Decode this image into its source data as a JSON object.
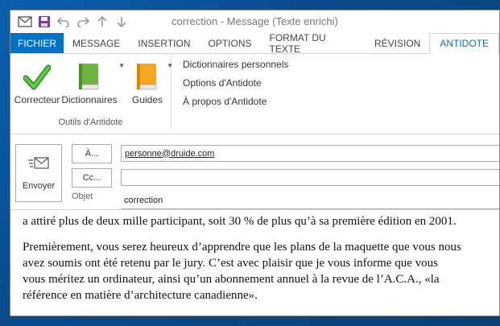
{
  "window": {
    "title": "correction - Message (Texte enrichi)"
  },
  "tabs": [
    "FICHIER",
    "MESSAGE",
    "INSERTION",
    "OPTIONS",
    "FORMAT DU TEXTE",
    "RÉVISION",
    "ANTIDOTE"
  ],
  "ribbon": {
    "big_buttons": {
      "correcteur": "Correcteur",
      "dictionnaires": "Dictionnaires",
      "guides": "Guides"
    },
    "group_label": "Outils d'Antidote",
    "menu_items": [
      "Dictionnaires personnels",
      "Options d'Antidote",
      "À propos d'Antidote"
    ]
  },
  "compose": {
    "send_label": "Envoyer",
    "to_button": "À...",
    "cc_button": "Cc...",
    "subject_label": "Objet",
    "to_value": "personne@druide.com",
    "cc_value": "",
    "subject_value": "correction"
  },
  "body_lines": [
    "a attiré plus de deux mille participant, soit 30 % de plus qu’à sa première édition en 2001.",
    "Premièrement, vous serez heureux d’apprendre que les plans de la maquette que vous nous",
    "avez soumis ont été retenu par le jury. C’est avec plaisir que je vous informe que vous",
    "vous méritez un ordinateur, ainsi qu’un abonnement annuel à la revue de l’A.C.A., «la",
    "référence en matière d’architecture canadienne»."
  ],
  "colors": {
    "accent": "#0072c6",
    "save_icon": "#7a3e9d",
    "check_icon": "#33a02c",
    "dictionary_icon": "#6cb33f",
    "guides_icon": "#f39c12"
  },
  "icons": [
    "mail-icon",
    "save-icon",
    "undo-icon",
    "redo-icon",
    "up-arrow-icon",
    "down-arrow-icon",
    "dropdown-icon",
    "check-icon",
    "book-icon",
    "send-envelope-icon"
  ]
}
